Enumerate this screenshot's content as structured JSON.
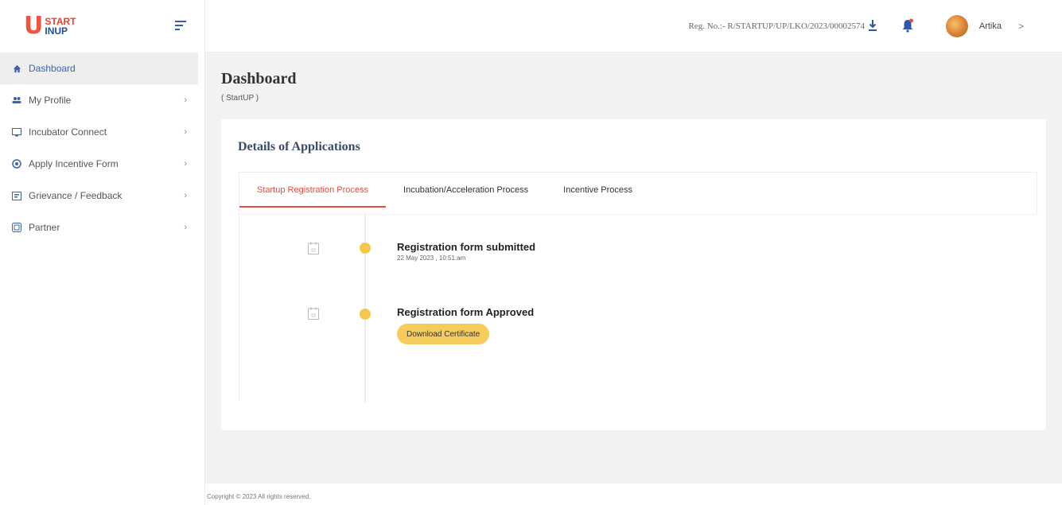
{
  "logo": {
    "start": "START",
    "inup": "INUP",
    "tagline": ""
  },
  "nav": [
    {
      "label": "Dashboard",
      "icon": "home-icon",
      "active": true
    },
    {
      "label": "My Profile",
      "icon": "users-icon"
    },
    {
      "label": "Incubator Connect",
      "icon": "monitor-icon"
    },
    {
      "label": "Apply Incentive Form",
      "icon": "coins-icon"
    },
    {
      "label": "Grievance / Feedback",
      "icon": "feedback-icon"
    },
    {
      "label": "Partner",
      "icon": "partner-icon"
    }
  ],
  "header": {
    "reg_no": "Reg. No.:- R/STARTUP/UP/LKO/2023/00002574",
    "username": "Artika",
    "chevron": ">"
  },
  "page": {
    "title": "Dashboard",
    "subtitle": "( StartUP )"
  },
  "card": {
    "title": "Details of Applications",
    "tabs": [
      {
        "label": "Startup Registration Process",
        "active": true
      },
      {
        "label": "Incubation/Acceleration Process"
      },
      {
        "label": "Incentive Process"
      }
    ],
    "timeline": [
      {
        "title": "Registration form submitted",
        "date": "22 May 2023 , 10:51:am"
      },
      {
        "title": "Registration form Approved",
        "button": "Download Certificate"
      }
    ]
  },
  "footer": {
    "copyright": "Copyright © 2023 All rights reserved."
  },
  "colors": {
    "accent": "#e74c3c",
    "brand_blue": "#3c64a8",
    "timeline_dot": "#f5c84c"
  }
}
